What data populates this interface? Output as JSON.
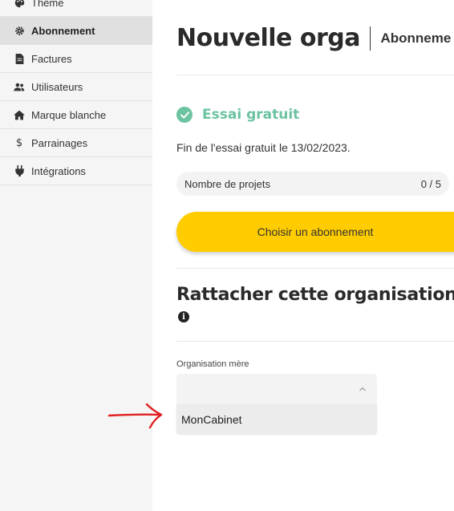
{
  "sidebar": {
    "items": [
      {
        "label": "Thème",
        "icon": "palette-icon",
        "active": false
      },
      {
        "label": "Abonnement",
        "icon": "gear-icon",
        "active": true
      },
      {
        "label": "Factures",
        "icon": "file-icon",
        "active": false
      },
      {
        "label": "Utilisateurs",
        "icon": "users-icon",
        "active": false
      },
      {
        "label": "Marque blanche",
        "icon": "home-icon",
        "active": false
      },
      {
        "label": "Parrainages",
        "icon": "dollar-icon",
        "active": false
      },
      {
        "label": "Intégrations",
        "icon": "plug-icon",
        "active": false
      }
    ]
  },
  "header": {
    "title": "Nouvelle orga",
    "subtitle": "Abonneme"
  },
  "subscription": {
    "status_label": "Essai gratuit",
    "trial_end_text": "Fin de l'essai gratuit le 13/02/2023.",
    "projects_label": "Nombre de projets",
    "projects_count": "0 / 5",
    "choose_button": "Choisir un abonnement"
  },
  "attach": {
    "title": "Rattacher cette organisation à",
    "field_label": "Organisation mère",
    "selected_value": "",
    "options": [
      "MonCabinet"
    ]
  },
  "colors": {
    "accent_yellow": "#ffcc00",
    "success_green": "#6cc3a0",
    "annotation_red": "#e02020"
  }
}
